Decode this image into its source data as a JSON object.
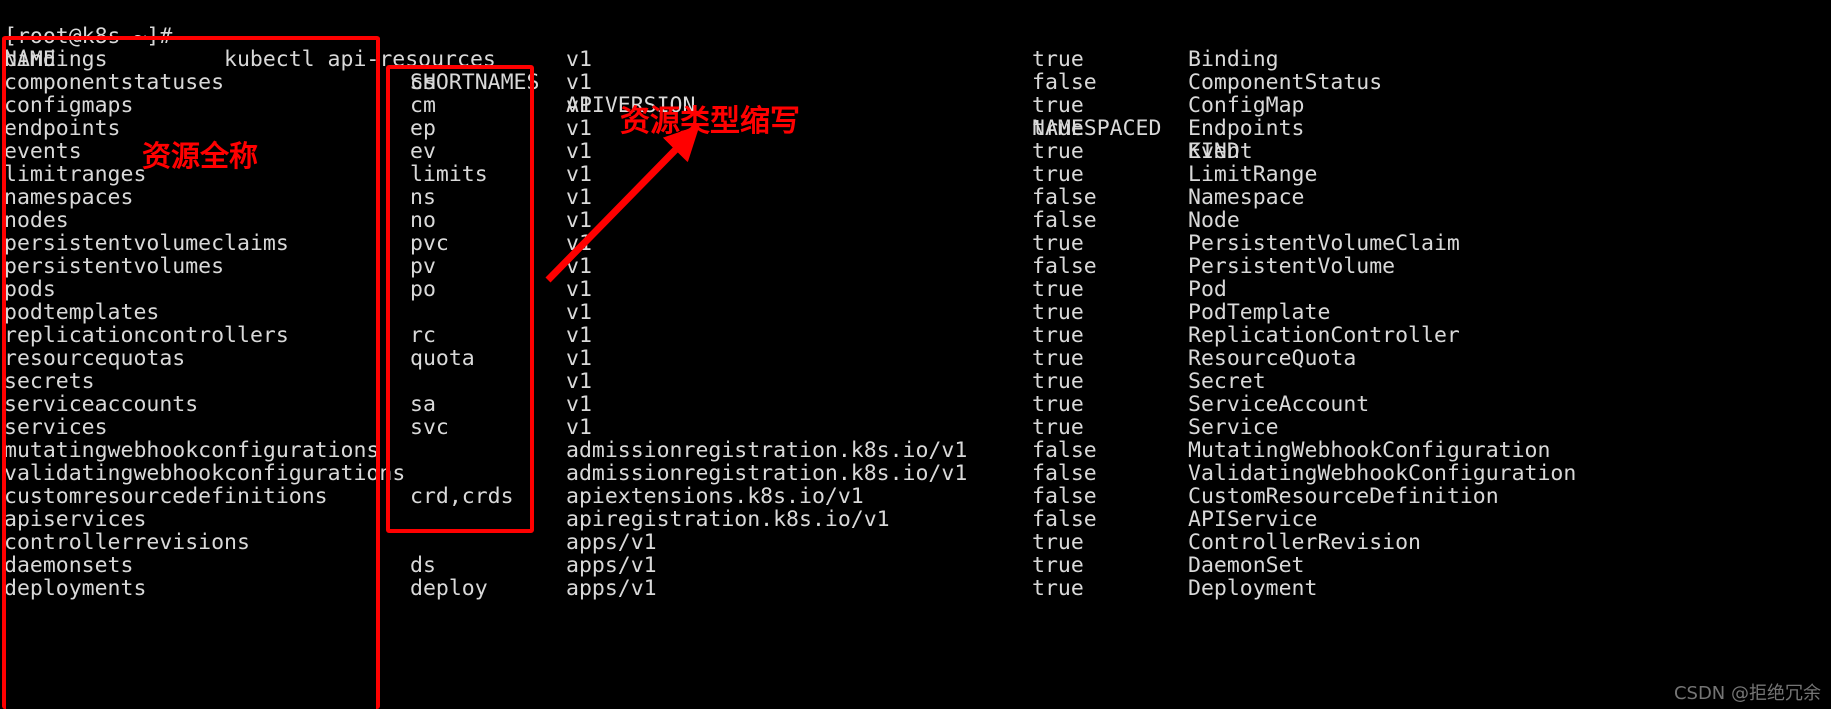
{
  "terminal": {
    "prompt": "[root@k8s ~]# ",
    "command": "kubectl api-resources",
    "background_color": "#000000",
    "text_color": "#d9d9d9",
    "accent_color": "#ff0000"
  },
  "table": {
    "headers": {
      "name": "NAME",
      "shortnames": "SHORTNAMES",
      "apiversion": "APIVERSION",
      "namespaced": "NAMESPACED",
      "kind": "KIND"
    },
    "rows": [
      {
        "name": "bindings",
        "shortnames": "",
        "apiversion": "v1",
        "namespaced": "true",
        "kind": "Binding"
      },
      {
        "name": "componentstatuses",
        "shortnames": "cs",
        "apiversion": "v1",
        "namespaced": "false",
        "kind": "ComponentStatus"
      },
      {
        "name": "configmaps",
        "shortnames": "cm",
        "apiversion": "v1",
        "namespaced": "true",
        "kind": "ConfigMap"
      },
      {
        "name": "endpoints",
        "shortnames": "ep",
        "apiversion": "v1",
        "namespaced": "true",
        "kind": "Endpoints"
      },
      {
        "name": "events",
        "shortnames": "ev",
        "apiversion": "v1",
        "namespaced": "true",
        "kind": "Event"
      },
      {
        "name": "limitranges",
        "shortnames": "limits",
        "apiversion": "v1",
        "namespaced": "true",
        "kind": "LimitRange"
      },
      {
        "name": "namespaces",
        "shortnames": "ns",
        "apiversion": "v1",
        "namespaced": "false",
        "kind": "Namespace"
      },
      {
        "name": "nodes",
        "shortnames": "no",
        "apiversion": "v1",
        "namespaced": "false",
        "kind": "Node"
      },
      {
        "name": "persistentvolumeclaims",
        "shortnames": "pvc",
        "apiversion": "v1",
        "namespaced": "true",
        "kind": "PersistentVolumeClaim"
      },
      {
        "name": "persistentvolumes",
        "shortnames": "pv",
        "apiversion": "v1",
        "namespaced": "false",
        "kind": "PersistentVolume"
      },
      {
        "name": "pods",
        "shortnames": "po",
        "apiversion": "v1",
        "namespaced": "true",
        "kind": "Pod"
      },
      {
        "name": "podtemplates",
        "shortnames": "",
        "apiversion": "v1",
        "namespaced": "true",
        "kind": "PodTemplate"
      },
      {
        "name": "replicationcontrollers",
        "shortnames": "rc",
        "apiversion": "v1",
        "namespaced": "true",
        "kind": "ReplicationController"
      },
      {
        "name": "resourcequotas",
        "shortnames": "quota",
        "apiversion": "v1",
        "namespaced": "true",
        "kind": "ResourceQuota"
      },
      {
        "name": "secrets",
        "shortnames": "",
        "apiversion": "v1",
        "namespaced": "true",
        "kind": "Secret"
      },
      {
        "name": "serviceaccounts",
        "shortnames": "sa",
        "apiversion": "v1",
        "namespaced": "true",
        "kind": "ServiceAccount"
      },
      {
        "name": "services",
        "shortnames": "svc",
        "apiversion": "v1",
        "namespaced": "true",
        "kind": "Service"
      },
      {
        "name": "mutatingwebhookconfigurations",
        "shortnames": "",
        "apiversion": "admissionregistration.k8s.io/v1",
        "namespaced": "false",
        "kind": "MutatingWebhookConfiguration"
      },
      {
        "name": "validatingwebhookconfigurations",
        "shortnames": "",
        "apiversion": "admissionregistration.k8s.io/v1",
        "namespaced": "false",
        "kind": "ValidatingWebhookConfiguration"
      },
      {
        "name": "customresourcedefinitions",
        "shortnames": "crd,crds",
        "apiversion": "apiextensions.k8s.io/v1",
        "namespaced": "false",
        "kind": "CustomResourceDefinition"
      },
      {
        "name": "apiservices",
        "shortnames": "",
        "apiversion": "apiregistration.k8s.io/v1",
        "namespaced": "false",
        "kind": "APIService"
      },
      {
        "name": "controllerrevisions",
        "shortnames": "",
        "apiversion": "apps/v1",
        "namespaced": "true",
        "kind": "ControllerRevision"
      },
      {
        "name": "daemonsets",
        "shortnames": "ds",
        "apiversion": "apps/v1",
        "namespaced": "true",
        "kind": "DaemonSet"
      },
      {
        "name": "deployments",
        "shortnames": "deploy",
        "apiversion": "apps/v1",
        "namespaced": "true",
        "kind": "Deployment"
      }
    ]
  },
  "annotations": {
    "name_label": "资源全称",
    "shortnames_label": "资源类型缩写",
    "color": "#ff0000"
  },
  "watermark": {
    "text": "CSDN @拒绝冗余"
  }
}
